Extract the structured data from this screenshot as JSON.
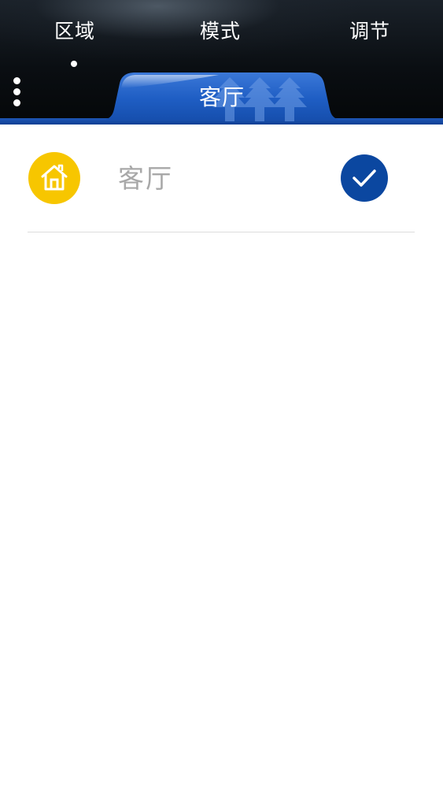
{
  "header": {
    "tabs": [
      {
        "label": "区域",
        "active": true
      },
      {
        "label": "模式",
        "active": false
      },
      {
        "label": "调节",
        "active": false
      }
    ],
    "menu_icon": "more-vertical-icon"
  },
  "room_tab": {
    "label": "客厅",
    "decoration_icon": "tree-watermark-icon"
  },
  "room_list": [
    {
      "name": "客厅",
      "icon": "home-icon",
      "selected": true,
      "selected_icon": "check-icon"
    }
  ],
  "colors": {
    "header_dark": "#0a0e12",
    "accent_blue": "#0b47a0",
    "home_yellow": "#f7c600",
    "room_text": "#a8a8a8",
    "divider": "#dcdcdc"
  }
}
